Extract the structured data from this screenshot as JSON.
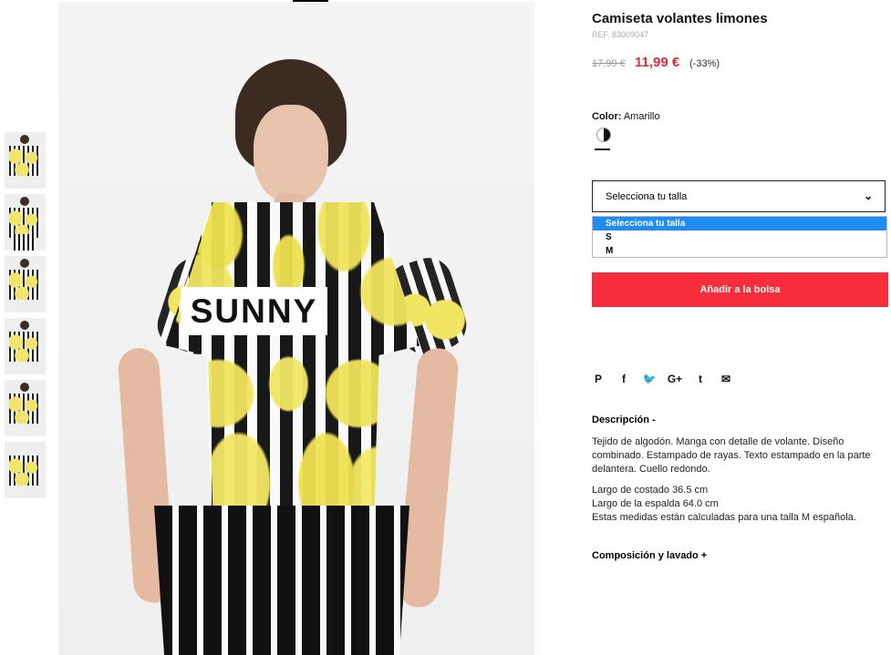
{
  "product": {
    "title": "Camiseta volantes limones",
    "ref": "REF. 83009047",
    "old_price": "17,99 €",
    "new_price": "11,99 €",
    "discount": "(-33%)",
    "color_label": "Color:",
    "color_value": "Amarillo",
    "size_select_placeholder": "Selecciona tu talla",
    "size_options": [
      "Selecciona tu talla",
      "S",
      "M"
    ],
    "add_to_bag": "Añadir a la bolsa",
    "description_title": "Descripción -",
    "description_text": "Tejido de algodón. Manga con detalle de volante. Diseño combinado. Estampado de rayas. Texto estampado en la parte delantera. Cuello redondo.",
    "measurements": [
      "Largo de costado 36.5 cm",
      "Largo de la espalda 64.0 cm",
      "Estas medidas están calculadas para una talla M española."
    ],
    "composition_title": "Composición y lavado +",
    "shirt_text": "SUNNY"
  },
  "icons": {
    "chevron": "chevron-down-icon",
    "share": [
      "pinterest-icon",
      "facebook-icon",
      "twitter-icon",
      "google-plus-icon",
      "tumblr-icon",
      "email-icon"
    ]
  },
  "colors": {
    "accent": "#f72d3c",
    "sale_price": "#e52a3a",
    "selected_option": "#1e8cf1"
  }
}
